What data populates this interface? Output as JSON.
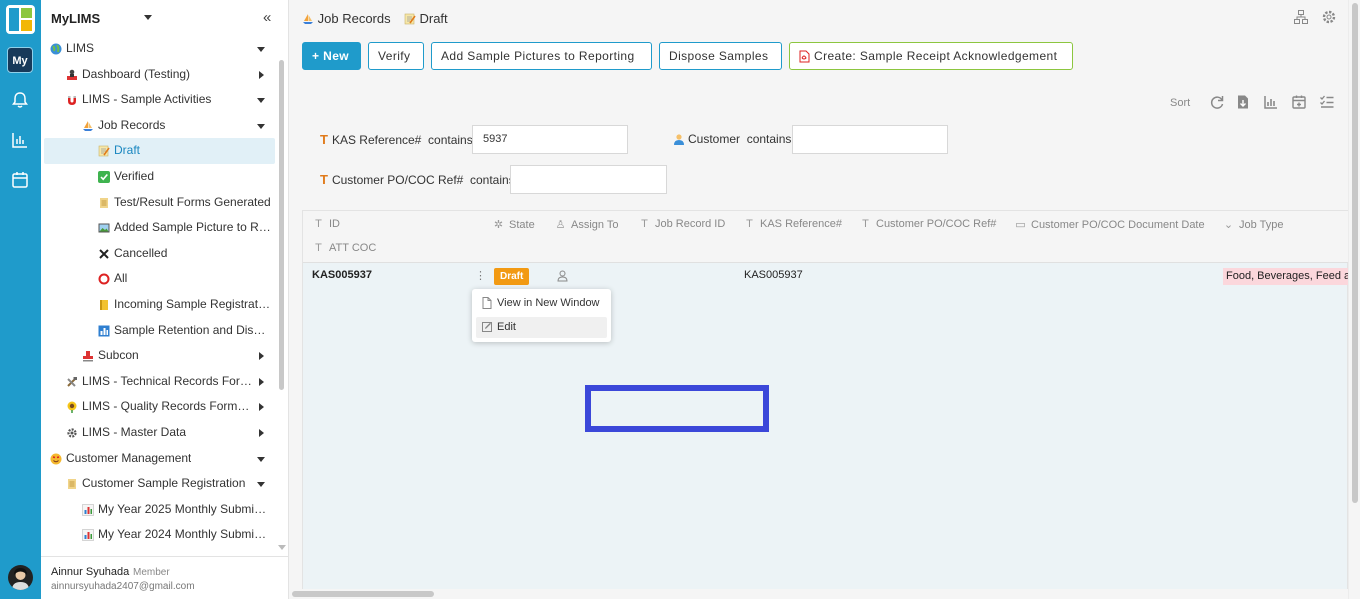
{
  "app": {
    "title": "MyLIMS",
    "rail_badge": "My"
  },
  "sidebar": {
    "items": [
      {
        "label": "LIMS",
        "icon": "globe-icon"
      },
      {
        "label": "Dashboard (Testing)",
        "icon": "person-icon"
      },
      {
        "label": "LIMS - Sample Activities",
        "icon": "magnet-icon"
      },
      {
        "label": "Job Records",
        "icon": "sailboat-icon"
      },
      {
        "label": "Draft",
        "icon": "memo-icon"
      },
      {
        "label": "Verified",
        "icon": "checkmark-icon"
      },
      {
        "label": "Test/Result Forms Generated",
        "icon": "scroll-icon"
      },
      {
        "label": "Added Sample Picture to Rep...",
        "icon": "picture-icon"
      },
      {
        "label": "Cancelled",
        "icon": "cross-icon"
      },
      {
        "label": "All",
        "icon": "circle-icon"
      },
      {
        "label": "Incoming Sample Registratio...",
        "icon": "ledger-icon"
      },
      {
        "label": "Sample Retention and Dispos...",
        "icon": "chart-icon"
      },
      {
        "label": "Subcon",
        "icon": "stamp-icon"
      },
      {
        "label": "LIMS - Technical Records Form ...",
        "icon": "tools-icon"
      },
      {
        "label": "LIMS - Quality Records Form (Q...",
        "icon": "sunflower-icon"
      },
      {
        "label": "LIMS - Master Data",
        "icon": "gear-icon"
      },
      {
        "label": "Customer Management",
        "icon": "smiley-icon"
      },
      {
        "label": "Customer Sample Registration",
        "icon": "scroll-icon"
      },
      {
        "label": "My Year 2025 Monthly Submissi...",
        "icon": "bar-chart-icon"
      },
      {
        "label": "My Year 2024 Monthly Submissi...",
        "icon": "bar-chart-icon"
      }
    ],
    "user": {
      "name": "Ainnur Syuhada",
      "role": "Member",
      "email": "ainnursyuhada2407@gmail.com"
    }
  },
  "breadcrumb": {
    "parent": "Job Records",
    "current": "Draft"
  },
  "toolbar": {
    "new_label": "+ New",
    "verify_label": "Verify",
    "add_pictures_label": "Add Sample Pictures to Reporting",
    "dispose_label": "Dispose Samples",
    "create_label": "Create: Sample Receipt Acknowledgement"
  },
  "sort_label": "Sort",
  "filters": {
    "kas_label": "KAS Reference#",
    "kas_op": "contains",
    "kas_value": "5937",
    "customer_label": "Customer",
    "customer_op": "contains",
    "customer_value": "",
    "po_label": "Customer PO/COC Ref#",
    "po_op": "contains",
    "po_value": ""
  },
  "grid": {
    "columns": [
      "ID",
      "State",
      "Assign To",
      "Job Record ID",
      "KAS Reference#",
      "Customer PO/COC Ref#",
      "Customer PO/COC Document Date",
      "Job Type",
      "ATT COC"
    ],
    "row": {
      "id": "KAS005937",
      "state": "Draft",
      "kas_ref": "KAS005937",
      "job_type": "Food, Beverages, Feed and"
    }
  },
  "context_menu": {
    "view_label": "View in New Window",
    "edit_label": "Edit"
  },
  "colors": {
    "accent": "#1f9bcb",
    "draft": "#f29a13",
    "highlight": "#3b47d9",
    "jobtype_tag": "#fbd7dc"
  }
}
